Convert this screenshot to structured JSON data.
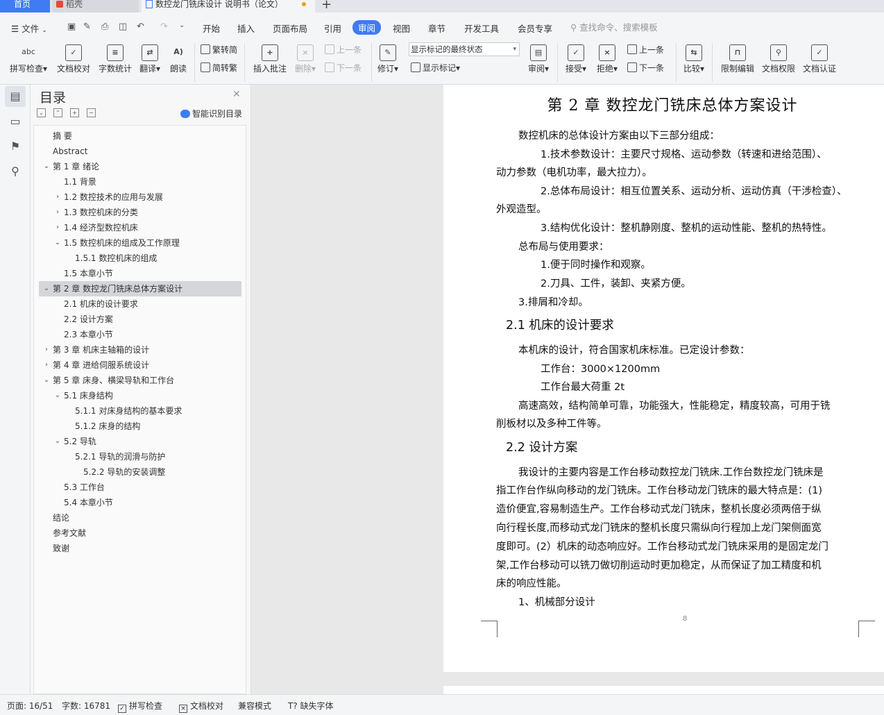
{
  "tabs": {
    "home": "首页",
    "wps": "稻壳",
    "doc": "数控龙门铣床设计 说明书（论文）"
  },
  "menu": {
    "file": "文件",
    "items": [
      "开始",
      "插入",
      "页面布局",
      "引用",
      "审阅",
      "视图",
      "章节",
      "开发工具",
      "会员专享"
    ],
    "active": "审阅",
    "search_placeholder": "查找命令、搜索模板"
  },
  "ribbon": {
    "spell": "拼写检查",
    "doc_check": "文档校对",
    "word_count": "字数统计",
    "translate": "翻译",
    "read_aloud": "朗读",
    "trad_simp": "繁转简",
    "simp_trad": "简转繁",
    "insert_comment": "插入批注",
    "delete": "删除",
    "prev_comment": "上一条",
    "next_comment": "下一条",
    "revise": "修订",
    "mark_state": "显示标记的最终状态",
    "show_marks": "显示标记",
    "review": "审阅",
    "accept": "接受",
    "reject": "拒绝",
    "prev": "上一条",
    "next": "下一条",
    "compare": "比较",
    "restrict_edit": "限制编辑",
    "doc_permission": "文档权限",
    "doc_cert": "文档认证"
  },
  "toc": {
    "title": "目录",
    "smart": "智能识别目录",
    "items": [
      {
        "label": "摘  要",
        "level": 0,
        "caret": ""
      },
      {
        "label": "Abstract",
        "level": 0,
        "caret": ""
      },
      {
        "label": "第 1 章   绪论",
        "level": 0,
        "caret": "v"
      },
      {
        "label": "1.1  背景",
        "level": 1,
        "caret": ""
      },
      {
        "label": "1.2  数控技术的应用与发展",
        "level": 1,
        "caret": ">"
      },
      {
        "label": "1.3  数控机床的分类",
        "level": 1,
        "caret": ">"
      },
      {
        "label": "1.4  经济型数控机床",
        "level": 1,
        "caret": ">"
      },
      {
        "label": "1.5  数控机床的组成及工作原理",
        "level": 1,
        "caret": "v"
      },
      {
        "label": "1.5.1  数控机床的组成",
        "level": 2,
        "caret": ""
      },
      {
        "label": "1.5  本章小节",
        "level": 1,
        "caret": ""
      },
      {
        "label": "第 2 章   数控龙门铣床总体方案设计",
        "level": 0,
        "caret": "v",
        "selected": true
      },
      {
        "label": "2.1  机床的设计要求",
        "level": 1,
        "caret": ""
      },
      {
        "label": "2.2  设计方案",
        "level": 1,
        "caret": ""
      },
      {
        "label": "2.3  本章小节",
        "level": 1,
        "caret": ""
      },
      {
        "label": "第 3 章  机床主轴箱的设计",
        "level": 0,
        "caret": ">"
      },
      {
        "label": "第 4 章  进给伺服系统设计",
        "level": 0,
        "caret": ">"
      },
      {
        "label": "第 5 章  床身、横梁导轨和工作台",
        "level": 0,
        "caret": "v"
      },
      {
        "label": "5.1  床身结构",
        "level": 1,
        "caret": "v"
      },
      {
        "label": "5.1.1  对床身结构的基本要求",
        "level": 2,
        "caret": ""
      },
      {
        "label": "5.1.2  床身的结构",
        "level": 2,
        "caret": ""
      },
      {
        "label": "5.2  导轨",
        "level": 1,
        "caret": "v"
      },
      {
        "label": "5.2.1  导轨的润滑与防护",
        "level": 2,
        "caret": ""
      },
      {
        "label": "5.2.2  导轨的安装调整",
        "level": 3,
        "caret": ""
      },
      {
        "label": "5.3  工作台",
        "level": 1,
        "caret": ""
      },
      {
        "label": "5.4  本章小节",
        "level": 1,
        "caret": ""
      },
      {
        "label": "结论",
        "level": 0,
        "caret": ""
      },
      {
        "label": "参考文献",
        "level": 0,
        "caret": ""
      },
      {
        "label": "致谢",
        "level": 0,
        "caret": ""
      }
    ]
  },
  "document": {
    "title": "第 2 章    数控龙门铣床总体方案设计",
    "lines": [
      "数控机床的总体设计方案由以下三部分组成：",
      "1.技术参数设计：主要尺寸规格、运动参数（转速和进给范围）、",
      "动力参数（电机功率，最大拉力）。",
      "2.总体布局设计：相互位置关系、运动分析、运动仿真（干涉检查）、",
      "外观造型。",
      "3.结构优化设计：整机静刚度、整机的运动性能、整机的热特性。",
      "总布局与使用要求：",
      "1.便于同时操作和观察。",
      "2.刀具、工件，装卸、夹紧方便。",
      "3.排屑和冷却。",
      "2.1  机床的设计要求",
      "本机床的设计，符合国家机床标准。已定设计参数：",
      "工作台：3000×1200mm",
      "工作台最大荷重 2t",
      "高速高效，结构简单可靠，功能强大，性能稳定，精度较高，可用于铣",
      "削板材以及多种工件等。",
      "2.2  设计方案",
      "我设计的主要内容是工作台移动数控龙门铣床.工作台数控龙门铣床是",
      "指工作台作纵向移动的龙门铣床。工作台移动龙门铣床的最大特点是：(1)",
      "造价便宜,容易制造生产。工作台移动式龙门铣床，整机长度必须两倍于纵",
      "向行程长度,而移动式龙门铣床的整机长度只需纵向行程加上龙门架侧面宽",
      "度即可。(2）机床的动态响应好。工作台移动式龙门铣床采用的是固定龙门",
      "架,工作台移动可以铣刀做切削运动时更加稳定，从而保证了加工精度和机",
      "床的响应性能。",
      "1、机械部分设计"
    ],
    "page_number": "8"
  },
  "status": {
    "page": "页面: 16/51",
    "words": "字数: 16781",
    "spell": "拼写检查",
    "doc_check": "文档校对",
    "compat": "兼容模式",
    "missing_font": "缺失字体"
  }
}
